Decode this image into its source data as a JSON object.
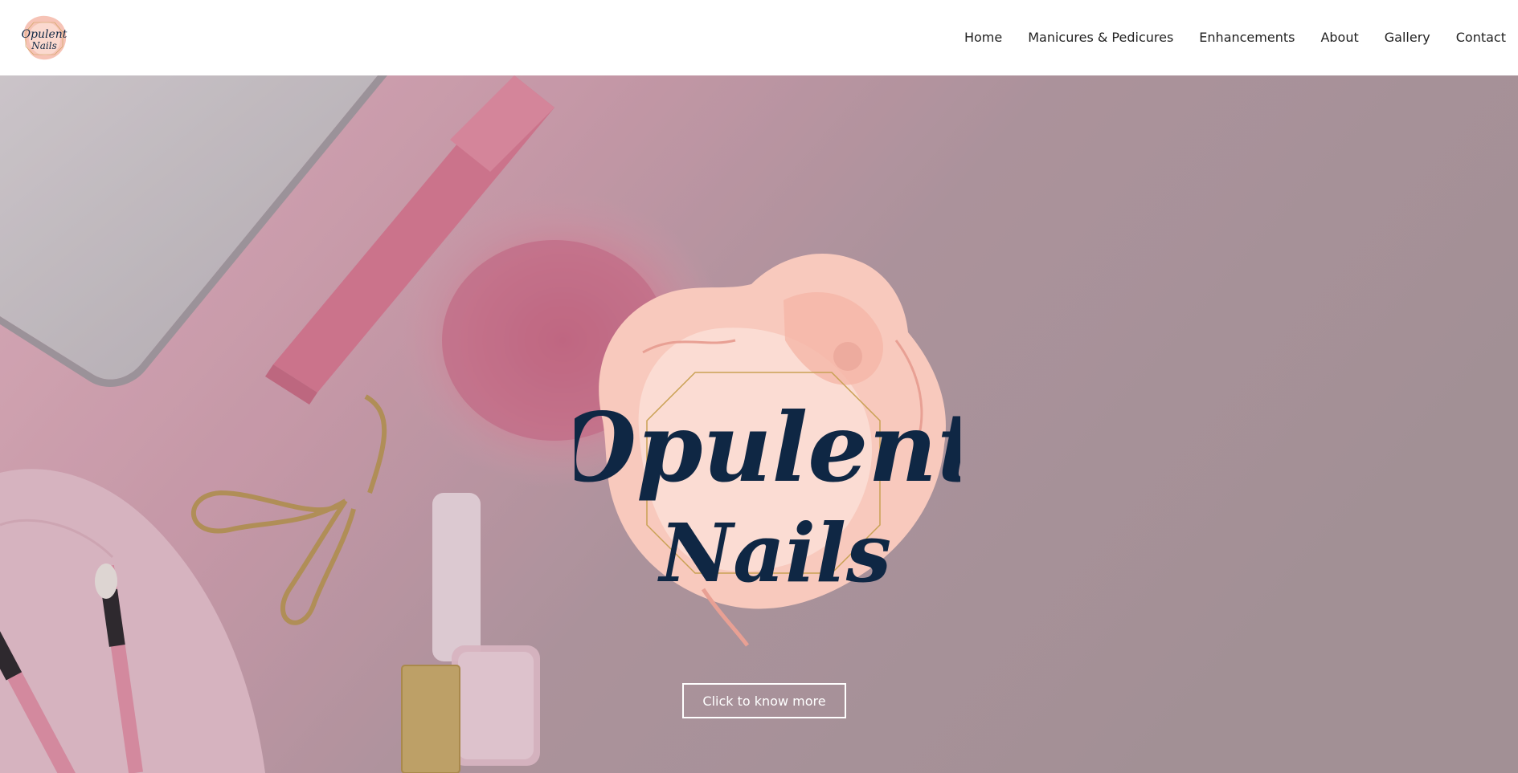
{
  "brand": {
    "name_line1": "Opulent",
    "name_line2": "Nails",
    "colors": {
      "navy": "#0f2744",
      "blush": "#f9cfc3",
      "rose_gold": "#e3a08c",
      "gold": "#c9a154"
    }
  },
  "header": {
    "logo_icon": "brand-logo",
    "nav": [
      {
        "label": "Home"
      },
      {
        "label": "Manicures & Pedicures"
      },
      {
        "label": "Enhancements"
      },
      {
        "label": "About"
      },
      {
        "label": "Gallery"
      },
      {
        "label": "Contact"
      }
    ]
  },
  "hero": {
    "background_description_icons": [
      "laptop-icon",
      "nail-file-icon",
      "fur-pompom-icon",
      "eyelash-curler-icon",
      "nail-polish-icon",
      "makeup-brush-icon",
      "towel-icon",
      "lipstick-icon"
    ],
    "cta_label": "Click to know more"
  }
}
